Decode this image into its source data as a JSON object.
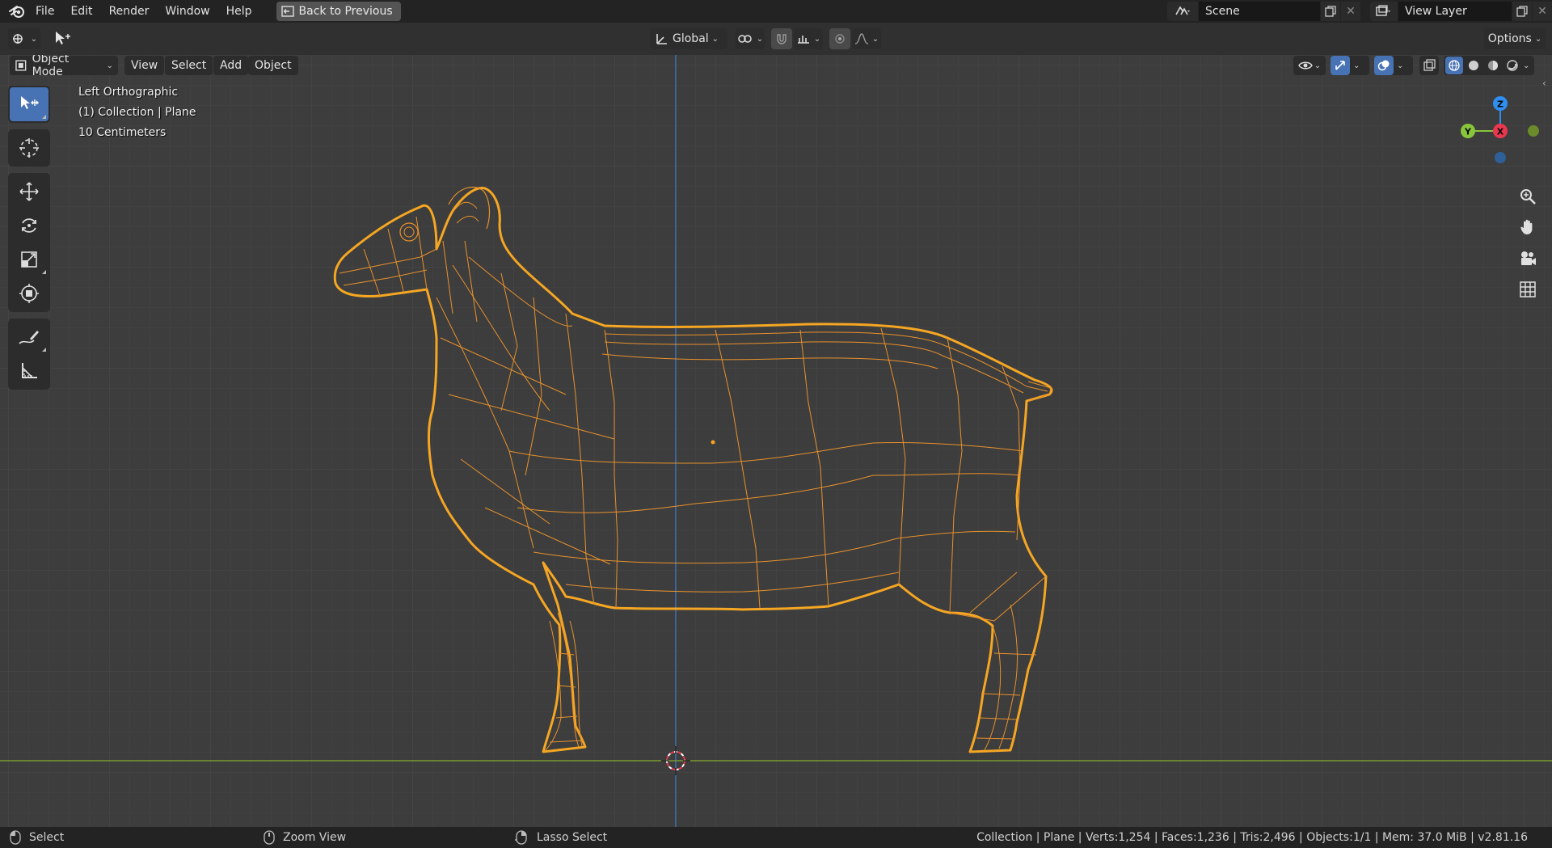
{
  "colors": {
    "accent": "#4772b3",
    "selection_outline": "#f5a623",
    "axis_x": "#e8384f",
    "axis_y": "#88c53a",
    "axis_z": "#2f8ff0",
    "viewport_bg": "#3d3d3d"
  },
  "topbar": {
    "menus": [
      "File",
      "Edit",
      "Render",
      "Window",
      "Help"
    ],
    "back_button": "Back to Previous",
    "scene": "Scene",
    "view_layer": "View Layer"
  },
  "header2": {
    "orientation": "Global",
    "options": "Options"
  },
  "view_header": {
    "mode": "Object Mode",
    "menus": [
      "View",
      "Select",
      "Add",
      "Object"
    ]
  },
  "overlay": {
    "view_name": "Left Orthographic",
    "collection": "(1) Collection | Plane",
    "scale": "10 Centimeters"
  },
  "gizmo": {
    "z": "Z",
    "y": "Y",
    "x": "X"
  },
  "toolbar": {
    "tools": [
      "select-box-icon",
      "cursor-icon",
      "move-icon",
      "rotate-icon",
      "scale-icon",
      "transform-icon",
      "annotate-icon",
      "measure-icon"
    ],
    "active": "select-box-icon"
  },
  "statusbar": {
    "select": "Select",
    "zoom": "Zoom View",
    "lasso": "Lasso Select",
    "info": "Collection | Plane | Verts:1,254 | Faces:1,236 | Tris:2,496 | Objects:1/1 | Mem: 37.0 MiB | v2.81.16"
  }
}
